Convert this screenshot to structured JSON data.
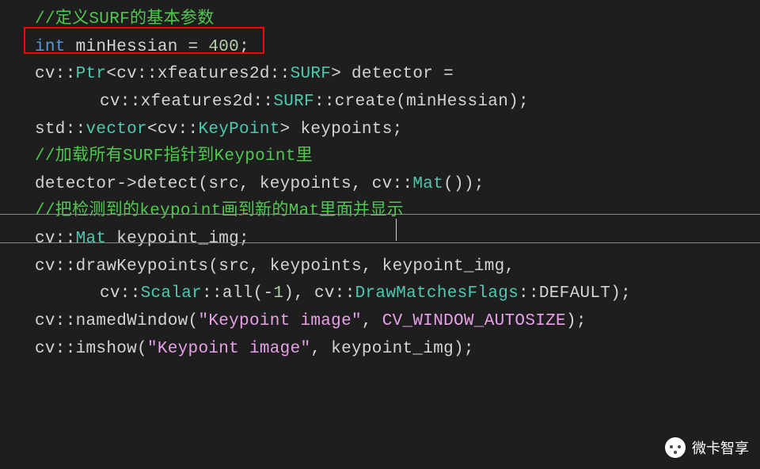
{
  "code": {
    "line1": "//定义SURF的基本参数",
    "line2_kw": "int",
    "line2_rest": " minHessian = ",
    "line2_num": "400",
    "line2_end": ";",
    "line3_a": "cv::",
    "line3_b": "Ptr",
    "line3_c": "<cv::xfeatures2d::",
    "line3_d": "SURF",
    "line3_e": "> detector =",
    "line4_a": "cv::xfeatures2d::",
    "line4_b": "SURF",
    "line4_c": "::",
    "line4_c2": "create",
    "line4_d": "(minHessian);",
    "line5_a": "std::",
    "line5_b": "vector",
    "line5_c": "<cv::",
    "line5_d": "KeyPoint",
    "line5_e": "> keypoints;",
    "line6": "//加载所有SURF指针到Keypoint里",
    "line7_a": "detector->detect(src, keypoints, cv::",
    "line7_b": "Mat",
    "line7_c": "());",
    "line8": "",
    "line9": "//把检测到的keypoint画到新的Mat里面并显示",
    "line10_a": "cv::",
    "line10_b": "Mat",
    "line10_c": " keypoint_img;",
    "line11_a": "cv::drawKeypoints(src, keypoints, keypoint_img,",
    "line12_a": "cv::",
    "line12_b": "Scalar",
    "line12_c": "::",
    "line12_c2": "all",
    "line12_d": "(-",
    "line12_e": "1",
    "line12_f": "), cv::",
    "line12_g": "DrawMatchesFlags",
    "line12_h": "::",
    "line12_h2": "DEFAULT",
    "line12_i": ");",
    "line13": "",
    "line14_a": "cv::namedWindow(",
    "line14_b": "\"Keypoint image\"",
    "line14_c": ", ",
    "line14_c2": "CV_WINDOW_AUTOSIZE",
    "line14_d": ");",
    "line15_a": "cv::imshow(",
    "line15_b": "\"Keypoint image\"",
    "line15_c": ", keypoint_img);"
  },
  "watermark": "微卡智享"
}
